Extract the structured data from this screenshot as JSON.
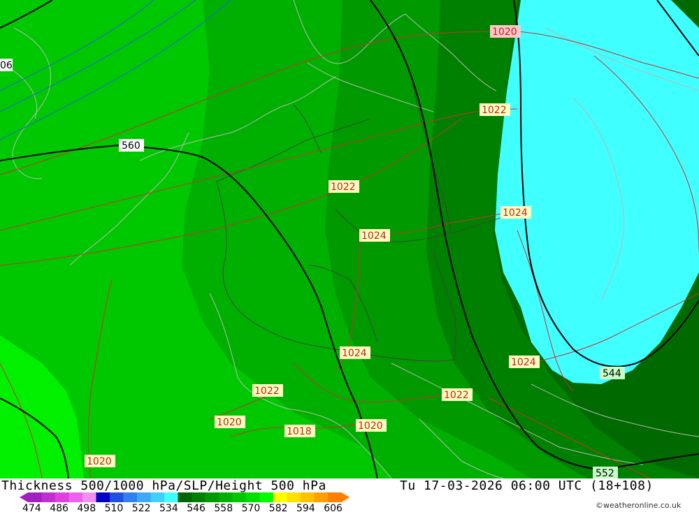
{
  "title": "Thickness 500/1000 hPa/SLP/Height 500 hPa",
  "datetime": "Tu 17-03-2026 06:00 UTC (18+108)",
  "credit": "©weatheronline.co.uk",
  "scale": {
    "labels": [
      "474",
      "486",
      "498",
      "510",
      "522",
      "534",
      "546",
      "558",
      "570",
      "582",
      "594",
      "606"
    ],
    "colors": [
      "#a020c0",
      "#c030d0",
      "#e040e0",
      "#f060f0",
      "#f090f0",
      "#0000cc",
      "#2050e0",
      "#3080f0",
      "#40a8f8",
      "#40d0ff",
      "#40ffff",
      "#006400",
      "#008000",
      "#009900",
      "#00b000",
      "#00c800",
      "#00e000",
      "#00ff00",
      "#ffff00",
      "#ffe000",
      "#ffc000",
      "#ffa000",
      "#ff8000"
    ]
  },
  "contours": {
    "height": [
      "560",
      "544",
      "552"
    ],
    "pressure": [
      "1020",
      "1022",
      "1022",
      "1024",
      "1024",
      "1024",
      "1024",
      "1022",
      "1020",
      "1018",
      "1020",
      "1022",
      "1020",
      "1024"
    ],
    "partial": "06"
  }
}
